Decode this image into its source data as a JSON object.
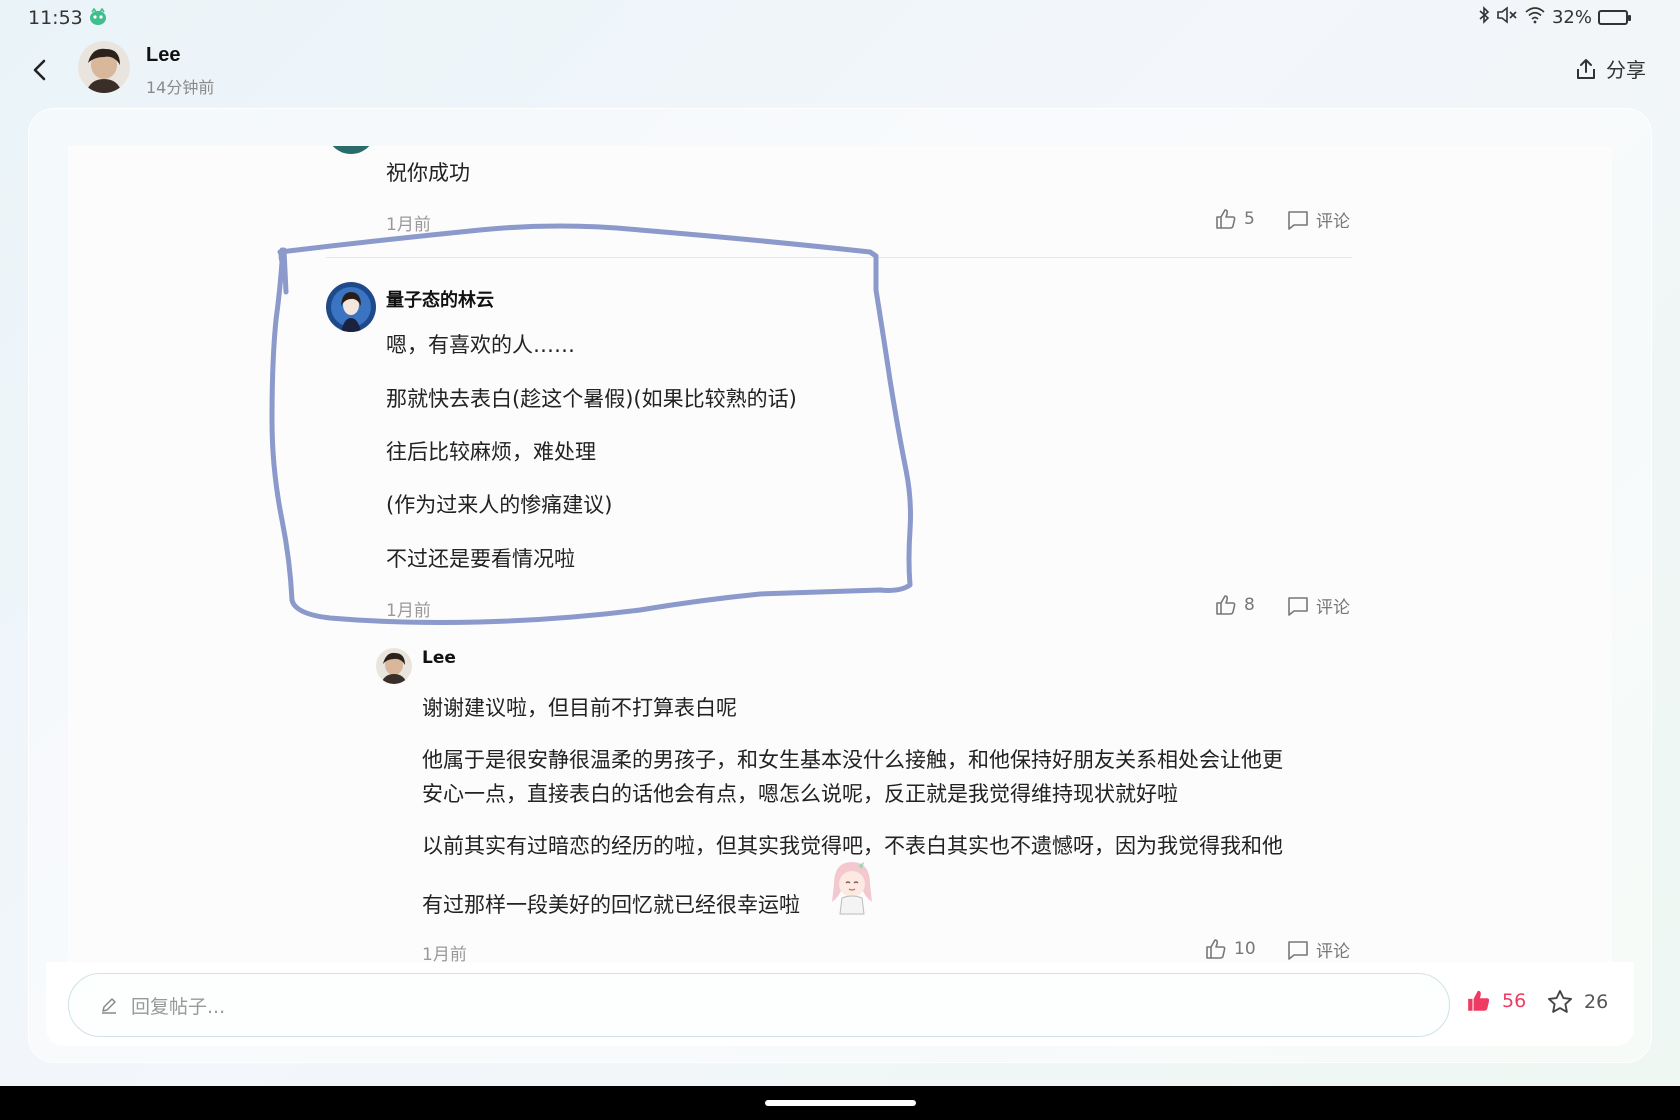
{
  "status_bar": {
    "time": "11:53",
    "battery": "32%",
    "battery_level": 0.32
  },
  "header": {
    "author": "Lee",
    "time": "14分钟前",
    "share_label": "分享"
  },
  "comments": [
    {
      "text": "祝你成功",
      "time": "1月前",
      "likes": "5",
      "comment_label": "评论"
    },
    {
      "username": "量子态的林云",
      "lines": [
        "嗯，有喜欢的人……",
        "那就快去表白(趁这个暑假)(如果比较熟的话)",
        "往后比较麻烦，难处理",
        "(作为过来人的惨痛建议)",
        "不过还是要看情况啦"
      ],
      "time": "1月前",
      "likes": "8",
      "comment_label": "评论"
    },
    {
      "username": "Lee",
      "lines": [
        "谢谢建议啦，但目前不打算表白呢",
        "他属于是很安静很温柔的男孩子，和女生基本没什么接触，和他保持好朋友关系相处会让他更",
        "安心一点，直接表白的话他会有点，嗯怎么说呢，反正就是我觉得维持现状就好啦",
        "以前其实有过暗恋的经历的啦，但其实我觉得吧，不表白其实也不遗憾呀，因为我觉得我和他",
        "有过那样一段美好的回忆就已经很幸运啦"
      ],
      "time": "1月前",
      "likes": "10",
      "comment_label": "评论"
    }
  ],
  "reply_bar": {
    "placeholder": "回复帖子...",
    "likes": "56",
    "favorites": "26"
  },
  "colors": {
    "accent_like": "#ef3b63",
    "annotation_stroke": "#8594c8"
  }
}
